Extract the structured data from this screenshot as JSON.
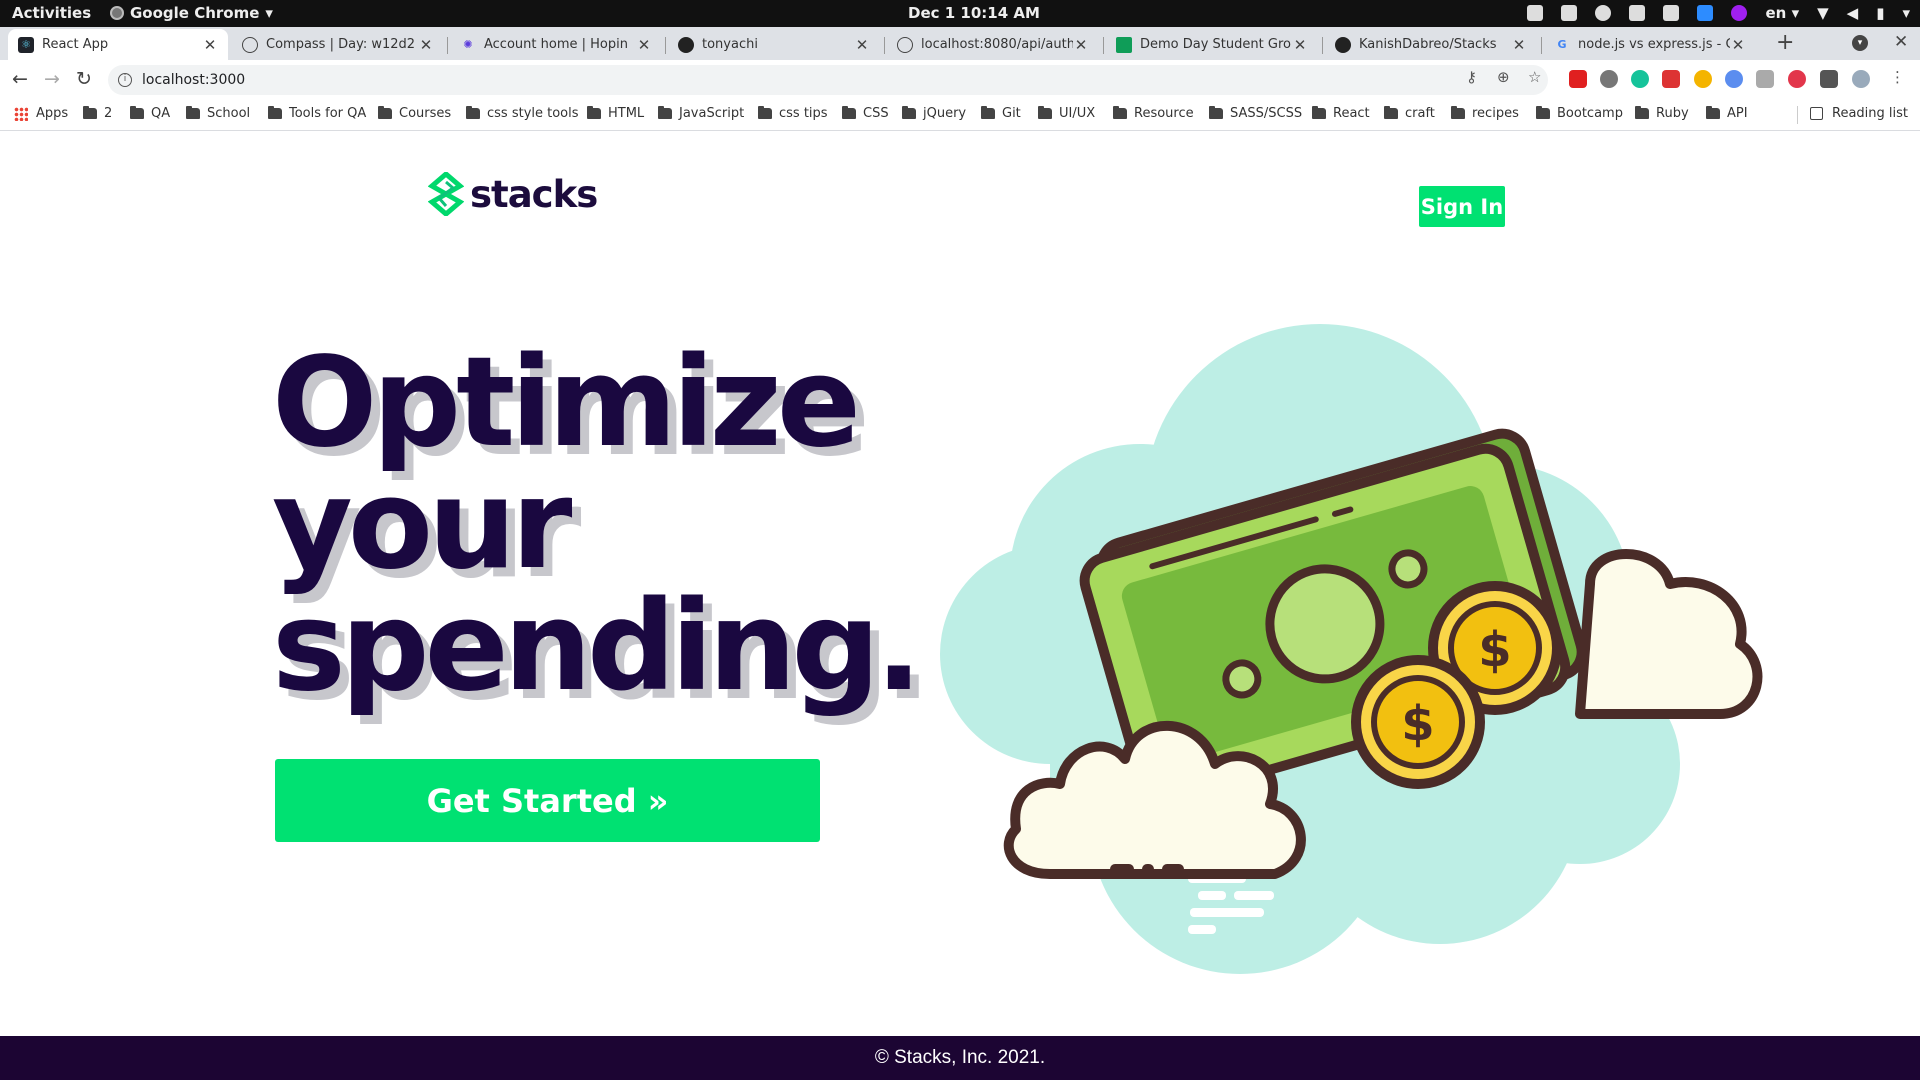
{
  "system_bar": {
    "activities": "Activities",
    "app_name": "Google Chrome",
    "clock": "Dec 1  10:14 AM",
    "language": "en"
  },
  "tabs": [
    {
      "title": "React App",
      "favicon": "react-icon"
    },
    {
      "title": "Compass | Day: w12d2",
      "favicon": "compass-icon"
    },
    {
      "title": "Account home | Hopin",
      "favicon": "hopin-icon"
    },
    {
      "title": "tonyachi",
      "favicon": "github-icon"
    },
    {
      "title": "localhost:8080/api/auth",
      "favicon": "globe-icon"
    },
    {
      "title": "Demo Day Student Groups",
      "favicon": "sheets-icon"
    },
    {
      "title": "KanishDabreo/Stacks",
      "favicon": "github-icon"
    },
    {
      "title": "node.js vs express.js - Goo",
      "favicon": "google-icon"
    }
  ],
  "address_bar": {
    "url": "localhost:3000"
  },
  "bookmarks": {
    "apps": "Apps",
    "folders": [
      "2",
      "QA",
      "School",
      "Tools for QA",
      "Courses",
      "css style tools",
      "HTML",
      "JavaScript",
      "css tips",
      "CSS",
      "jQuery",
      "Git",
      "UI/UX",
      "Resource",
      "SASS/SCSS",
      "React",
      "craft",
      "recipes",
      "Bootcamp",
      "Ruby",
      "API"
    ],
    "reading_list": "Reading list"
  },
  "page": {
    "logo_text": "stacks",
    "sign_in": "Sign In",
    "hero_line1": "Optimize",
    "hero_line2": "your",
    "hero_line3": "spending.",
    "cta": "Get Started »",
    "footer": "© Stacks, Inc. 2021."
  },
  "colors": {
    "accent_green": "#00e172",
    "hero_text": "#1a0840",
    "footer_bg": "#1c0533",
    "cloud_teal": "#bdeee5",
    "bill_green": "#77ba3d",
    "coin_gold": "#f2c010"
  }
}
